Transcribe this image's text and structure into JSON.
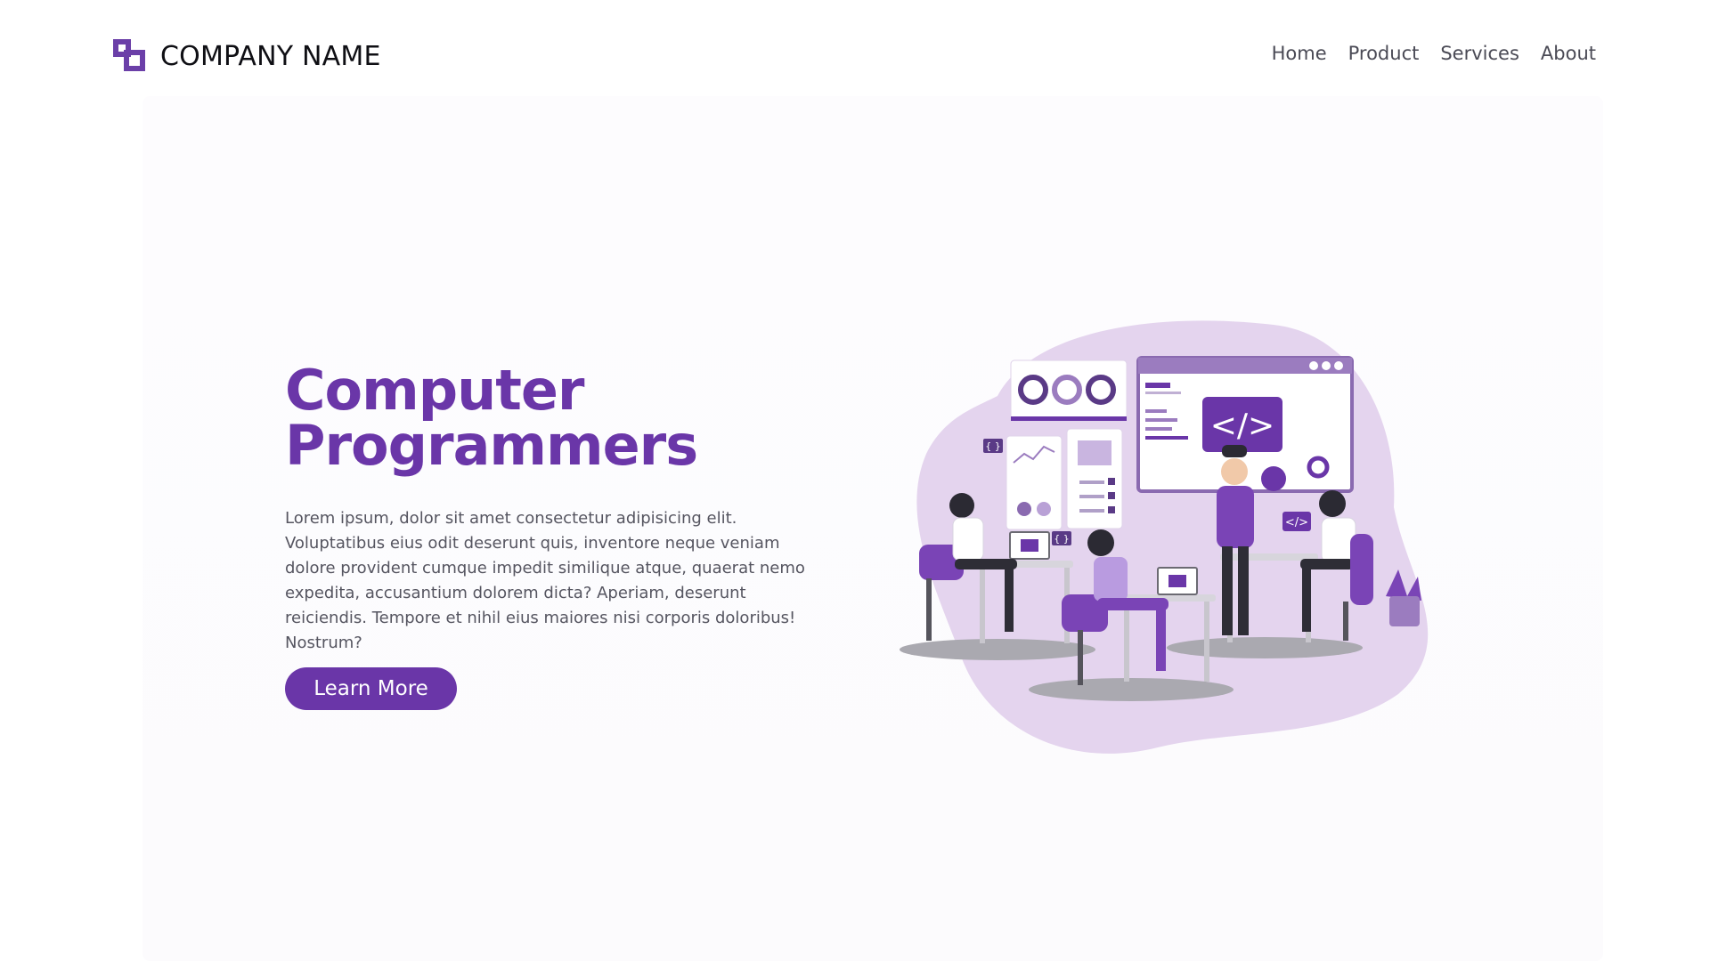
{
  "header": {
    "company_name": "COMPANY NAME",
    "nav": [
      "Home",
      "Product",
      "Services",
      "About"
    ]
  },
  "hero": {
    "title_line1": "Computer",
    "title_line2": "Programmers",
    "description": "Lorem ipsum, dolor sit amet consectetur adipisicing elit. Voluptatibus eius odit deserunt quis, inventore neque veniam dolore provident cumque impedit similique atque, quaerat nemo expedita, accusantium dolorem dicta? Aperiam, deserunt reiciendis. Tempore et nihil eius maiores nisi corporis doloribus! Nostrum?",
    "cta_label": "Learn More"
  },
  "illustration": {
    "code_symbol": "</>",
    "brace_symbol": "{ }"
  },
  "colors": {
    "accent": "#6a36a8",
    "blob": "#e4d4ee",
    "text_dark": "#0f0f14",
    "text_body": "#555560"
  }
}
